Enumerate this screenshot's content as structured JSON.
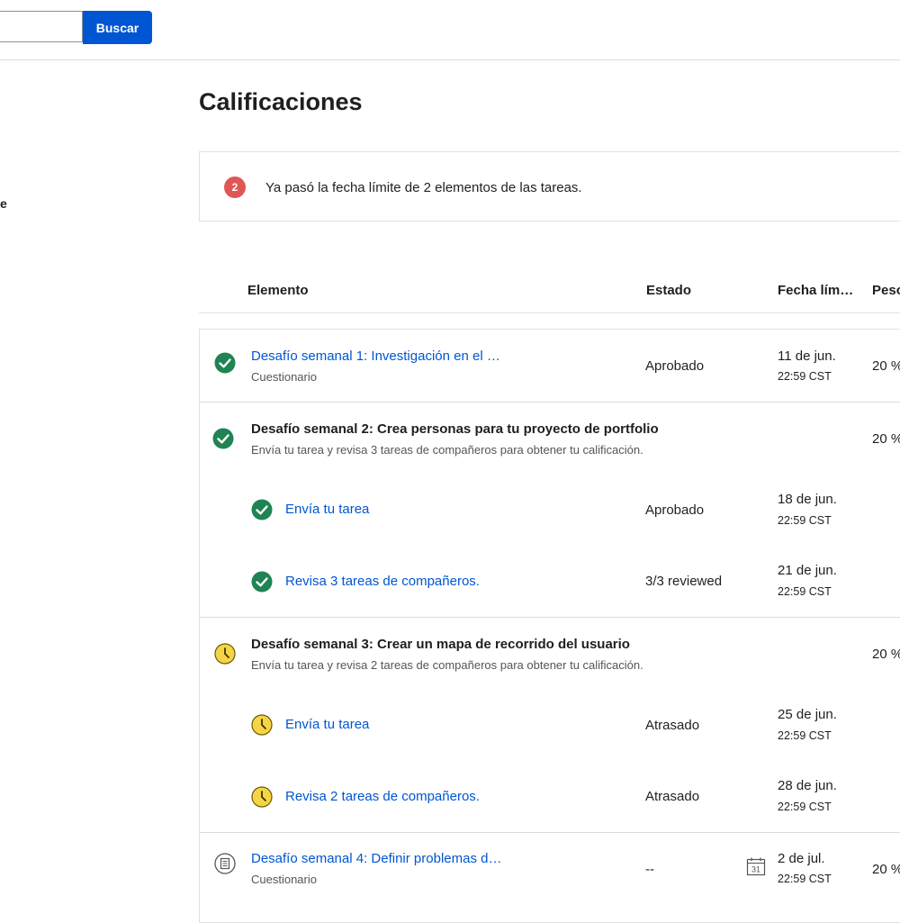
{
  "search": {
    "placeholder": "",
    "button_label": "Buscar"
  },
  "sidebar": {
    "partial_label": "e"
  },
  "page": {
    "title": "Calificaciones"
  },
  "alert": {
    "count": "2",
    "message": "Ya pasó la fecha límite de 2 elementos de las tareas."
  },
  "table": {
    "headers": {
      "element": "Elemento",
      "status": "Estado",
      "due": "Fecha lím…",
      "weight": "Peso"
    },
    "items": [
      {
        "title": "Desafío semanal 1: Investigación en el …",
        "type": "Cuestionario",
        "status": "Aprobado",
        "date": "11 de jun.",
        "time": "22:59 CST",
        "weight": "20 %",
        "icon": "check-icon"
      },
      {
        "title": "Desafío semanal 2: Crea personas para tu proyecto de portfolio",
        "description": "Envía tu tarea y revisa 3 tareas de compañeros para obtener tu calificación.",
        "weight": "20 %",
        "icon": "check-icon",
        "subitems": [
          {
            "title": "Envía tu tarea",
            "status": "Aprobado",
            "date": "18 de jun.",
            "time": "22:59 CST",
            "icon": "check-icon"
          },
          {
            "title": "Revisa 3 tareas de compañeros.",
            "status": "3/3 reviewed",
            "date": "21 de jun.",
            "time": "22:59 CST",
            "icon": "check-icon"
          }
        ]
      },
      {
        "title": "Desafío semanal 3: Crear un mapa de recorrido del usuario",
        "description": "Envía tu tarea y revisa 2 tareas de compañeros para obtener tu calificación.",
        "weight": "20 %",
        "icon": "clock-icon",
        "subitems": [
          {
            "title": "Envía tu tarea",
            "status": "Atrasado",
            "date": "25 de jun.",
            "time": "22:59 CST",
            "icon": "clock-icon"
          },
          {
            "title": "Revisa 2 tareas de compañeros.",
            "status": "Atrasado",
            "date": "28 de jun.",
            "time": "22:59 CST",
            "icon": "clock-icon"
          }
        ]
      },
      {
        "title": "Desafío semanal 4: Definir problemas d…",
        "type": "Cuestionario",
        "status": "--",
        "date": "2 de jul.",
        "time": "22:59 CST",
        "weight": "20 %",
        "icon": "quiz-icon",
        "calendar_day": "31"
      }
    ]
  },
  "colors": {
    "accent": "#0056d2",
    "success": "#1f8354",
    "warning": "#f5d547",
    "alert": "#e05656"
  }
}
